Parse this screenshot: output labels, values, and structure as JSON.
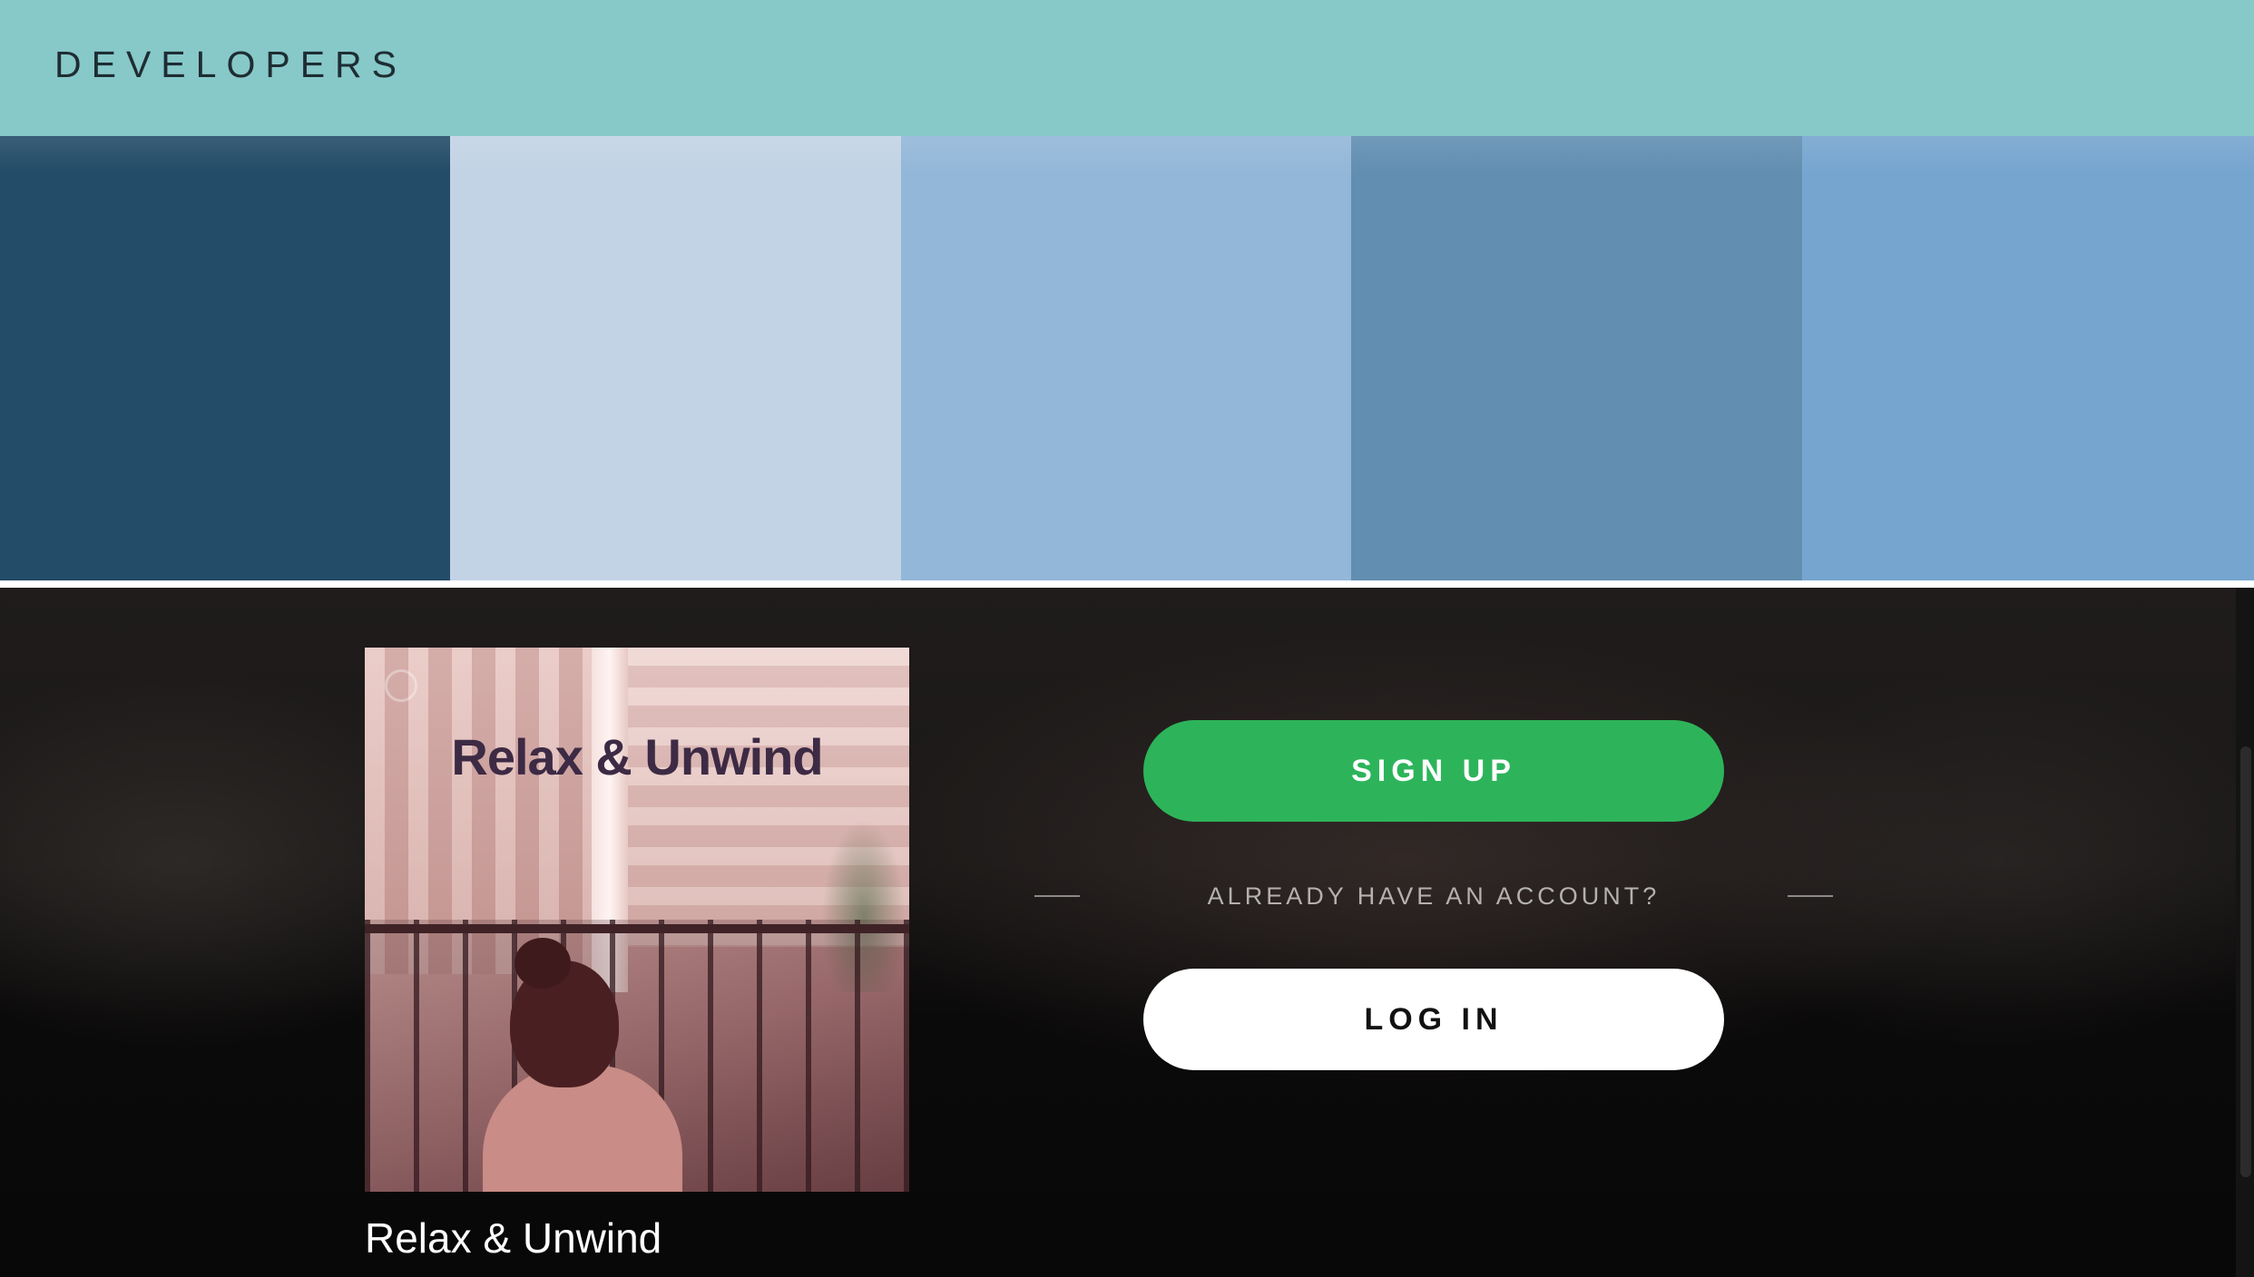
{
  "header": {
    "brand": "DEVELOPERS"
  },
  "palette": {
    "swatches": [
      {
        "name": "deep-navy",
        "color": "#234c68"
      },
      {
        "name": "pale-blue",
        "color": "#c2d3e5"
      },
      {
        "name": "light-blue",
        "color": "#93b7d8"
      },
      {
        "name": "steel-blue",
        "color": "#618eb1"
      },
      {
        "name": "sky-blue",
        "color": "#76a5cf"
      }
    ]
  },
  "player": {
    "cover_title": "Relax & Unwind",
    "playlist_name": "Relax & Unwind",
    "signup_label": "SIGN UP",
    "already_text": "ALREADY HAVE AN ACCOUNT?",
    "login_label": "LOG IN"
  },
  "colors": {
    "header_bg": "#87c8c9",
    "signup_bg": "#2db45a",
    "login_bg": "#ffffff"
  }
}
